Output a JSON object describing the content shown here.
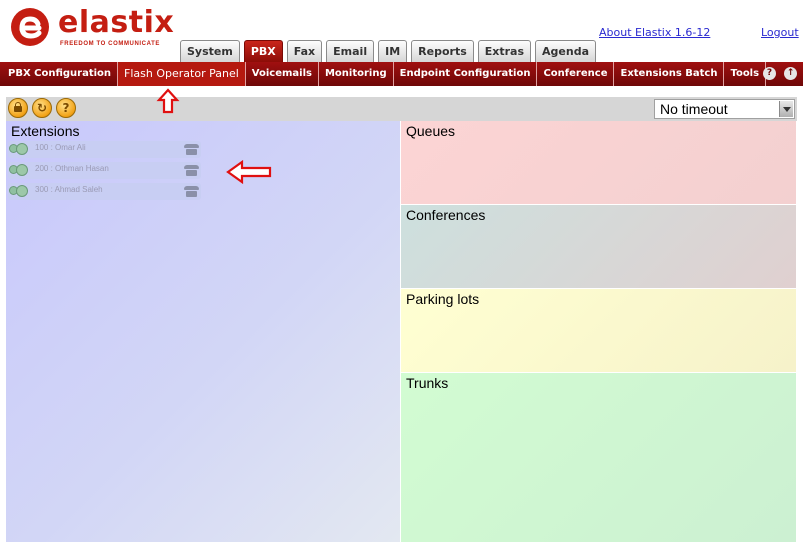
{
  "brand": {
    "name": "elastix",
    "tagline": "FREEDOM TO COMMUNICATE",
    "color": "#c41e12"
  },
  "top_tabs": [
    {
      "label": "System",
      "active": false
    },
    {
      "label": "PBX",
      "active": true
    },
    {
      "label": "Fax",
      "active": false
    },
    {
      "label": "Email",
      "active": false
    },
    {
      "label": "IM",
      "active": false
    },
    {
      "label": "Reports",
      "active": false
    },
    {
      "label": "Extras",
      "active": false
    },
    {
      "label": "Agenda",
      "active": false
    }
  ],
  "header_links": {
    "about": "About Elastix 1.6-12",
    "logout": "Logout"
  },
  "subnav": {
    "items": [
      {
        "label": "PBX Configuration",
        "active": false
      },
      {
        "label": "Flash Operator Panel",
        "active": true
      },
      {
        "label": "Voicemails",
        "active": false
      },
      {
        "label": "Monitoring",
        "active": false
      },
      {
        "label": "Endpoint Configuration",
        "active": false
      },
      {
        "label": "Conference",
        "active": false
      },
      {
        "label": "Extensions Batch",
        "active": false
      },
      {
        "label": "Tools",
        "active": false
      }
    ],
    "icons": [
      "help-icon",
      "info-icon"
    ],
    "background": "#8c0d08"
  },
  "toolbar": {
    "buttons": [
      "lock-icon",
      "refresh-icon",
      "help-icon"
    ],
    "timeout_value": "No timeout"
  },
  "panels": {
    "extensions": {
      "title": "Extensions",
      "items": [
        {
          "label": "100 : Omar Ali"
        },
        {
          "label": "200 : Othman Hasan"
        },
        {
          "label": "300 : Ahmad Saleh"
        }
      ],
      "color": "#c8c8fc"
    },
    "queues": {
      "title": "Queues",
      "color": "#fcd4d4"
    },
    "conferences": {
      "title": "Conferences",
      "color": "#cde0de"
    },
    "parking": {
      "title": "Parking lots",
      "color": "#ffffd2"
    },
    "trunks": {
      "title": "Trunks",
      "color": "#d2fcd2"
    }
  },
  "annotations": {
    "arrow_color": "#e01010"
  }
}
